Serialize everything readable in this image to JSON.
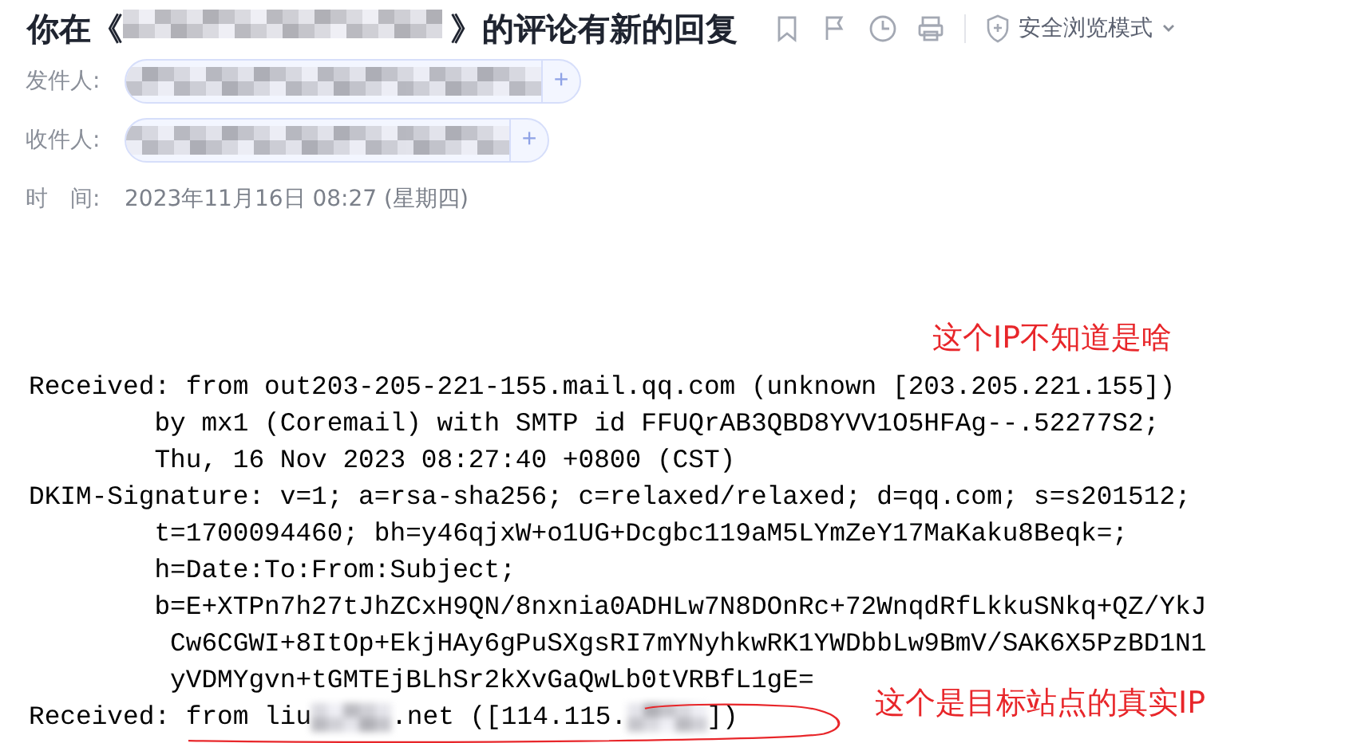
{
  "subject": {
    "prefix": "你在《",
    "suffix": "》的评论有新的回复"
  },
  "toolbar": {
    "safe_mode": "安全浏览模式"
  },
  "fields": [
    {
      "kind": "contact",
      "label": "发件人:",
      "add": "+"
    },
    {
      "kind": "contact",
      "label": "收件人:",
      "add": "+"
    },
    {
      "kind": "text",
      "label": "时　间:",
      "value": "2023年11月16日 08:27 (星期四)"
    }
  ],
  "headers": [
    {
      "parts": [
        {
          "kind": "text",
          "text": "Received: from out203-205-221-155.mail.qq.com (unknown [203.205.221.155])"
        }
      ]
    },
    {
      "parts": [
        {
          "kind": "text",
          "text": "        by mx1 (Coremail) with SMTP id FFUQrAB3QBD8YVV1O5HFAg--.52277S2;"
        }
      ]
    },
    {
      "parts": [
        {
          "kind": "text",
          "text": "        Thu, 16 Nov 2023 08:27:40 +0800 (CST)"
        }
      ]
    },
    {
      "parts": [
        {
          "kind": "text",
          "text": "DKIM-Signature: v=1; a=rsa-sha256; c=relaxed/relaxed; d=qq.com; s=s201512;"
        }
      ]
    },
    {
      "parts": [
        {
          "kind": "text",
          "text": "        t=1700094460; bh=y46qjxW+o1UG+Dcgbc119aM5LYmZeY17MaKaku8Beqk=;"
        }
      ]
    },
    {
      "parts": [
        {
          "kind": "text",
          "text": "        h=Date:To:From:Subject;"
        }
      ]
    },
    {
      "parts": [
        {
          "kind": "text",
          "text": "        b=E+XTPn7h27tJhZCxH9QN/8nxnia0ADHLw7N8DOnRc+72WnqdRfLkkuSNkq+QZ/YkJ"
        }
      ]
    },
    {
      "parts": [
        {
          "kind": "text",
          "text": "         Cw6CGWI+8ItOp+EkjHAy6gPuSXgsRI7mYNyhkwRK1YWDbbLw9BmV/SAK6X5PzBD1N1"
        }
      ]
    },
    {
      "parts": [
        {
          "kind": "text",
          "text": "         yVDMYgvn+tGMTEjBLhSr2kXvGaQwLb0tVRBfL1gE="
        }
      ]
    },
    {
      "parts": [
        {
          "kind": "text",
          "text": "Received: from liu"
        },
        {
          "kind": "redacted"
        },
        {
          "kind": "text",
          "text": ".net ([114.115."
        },
        {
          "kind": "redacted"
        },
        {
          "kind": "text",
          "text": "])"
        }
      ],
      "circled": true
    }
  ],
  "annotations": [
    {
      "text": "这个IP不知道是啥"
    },
    {
      "text": "这个是目标站点的真实IP"
    }
  ]
}
